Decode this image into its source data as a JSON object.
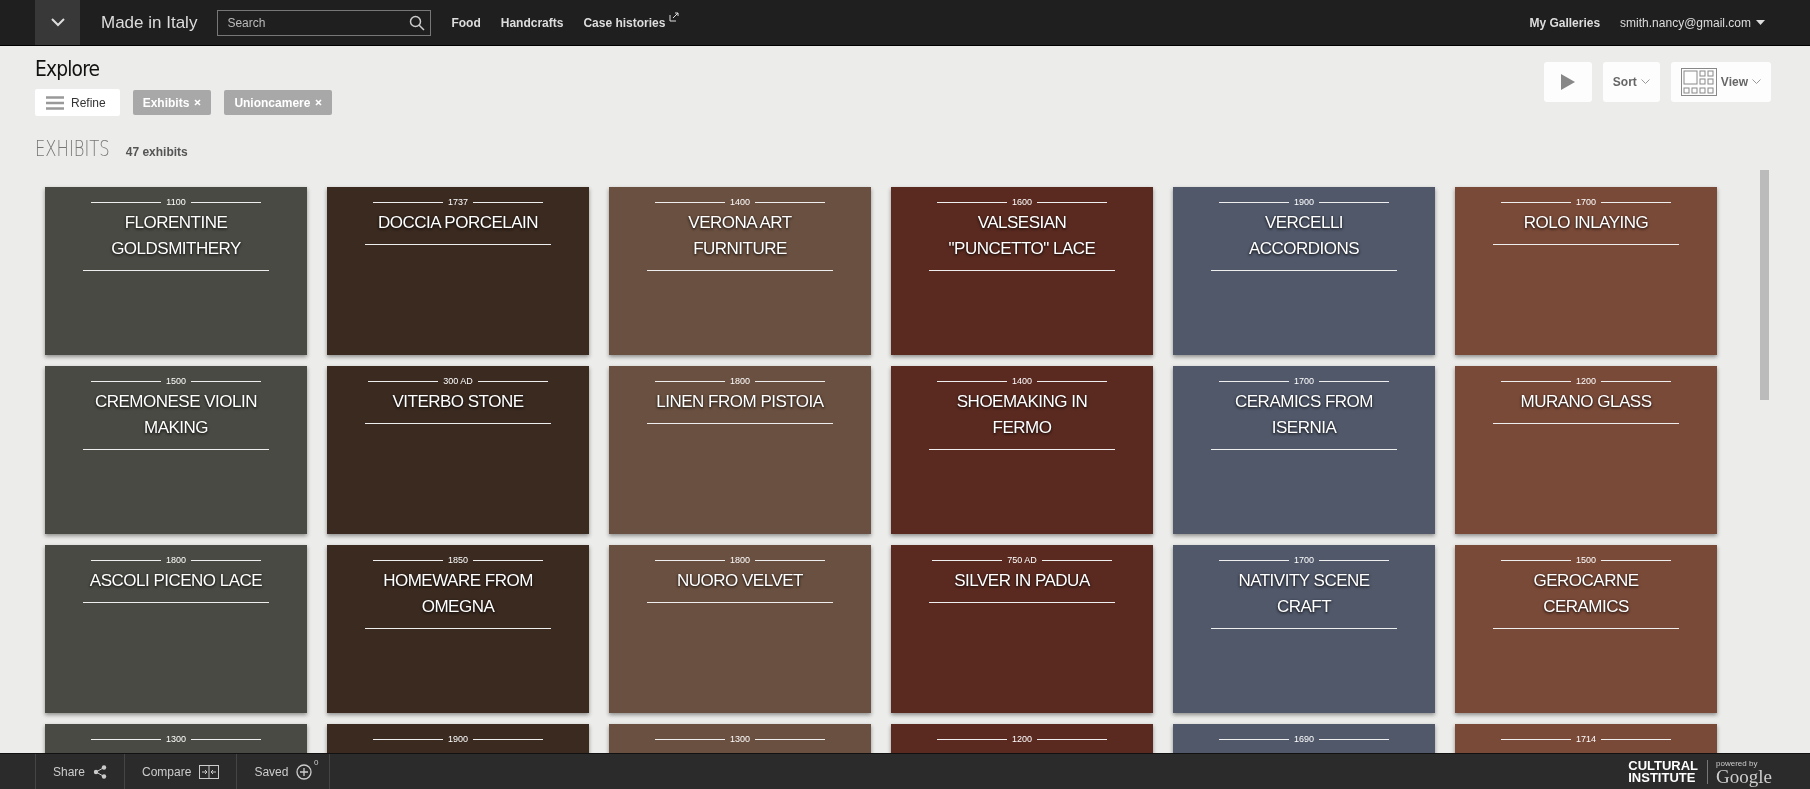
{
  "topbar": {
    "site_title": "Made in Italy",
    "search": {
      "placeholder": "Search"
    },
    "nav": [
      {
        "label": "Food",
        "external": false
      },
      {
        "label": "Handcrafts",
        "external": false
      },
      {
        "label": "Case histories",
        "external": true
      }
    ],
    "galleries": "My Galleries",
    "user": "smith.nancy@gmail.com"
  },
  "page_title": "Explore",
  "refine": "Refine",
  "filters": [
    "Exhibits",
    "Unioncamere"
  ],
  "toolbar": {
    "sort": "Sort",
    "view": "View"
  },
  "section": {
    "title": "EXHIBITS",
    "count": "47 exhibits"
  },
  "exhibits": [
    {
      "year": "1100",
      "title": "FLORENTINE GOLDSMITHERY"
    },
    {
      "year": "1737",
      "title": "DOCCIA PORCELAIN"
    },
    {
      "year": "1400",
      "title": "VERONA ART FURNITURE"
    },
    {
      "year": "1600",
      "title": "VALSESIAN \"PUNCETTO\" LACE"
    },
    {
      "year": "1900",
      "title": "VERCELLI ACCORDIONS"
    },
    {
      "year": "1700",
      "title": "ROLO INLAYING"
    },
    {
      "year": "1500",
      "title": "CREMONESE VIOLIN MAKING"
    },
    {
      "year": "300 AD",
      "title": "VITERBO STONE"
    },
    {
      "year": "1800",
      "title": "LINEN FROM PISTOIA"
    },
    {
      "year": "1400",
      "title": "SHOEMAKING IN FERMO"
    },
    {
      "year": "1700",
      "title": "CERAMICS FROM ISERNIA"
    },
    {
      "year": "1200",
      "title": "MURANO GLASS"
    },
    {
      "year": "1800",
      "title": "ASCOLI PICENO LACE"
    },
    {
      "year": "1850",
      "title": "HOMEWARE FROM OMEGNA"
    },
    {
      "year": "1800",
      "title": "NUORO VELVET"
    },
    {
      "year": "750 AD",
      "title": "SILVER IN PADUA"
    },
    {
      "year": "1700",
      "title": "NATIVITY SCENE CRAFT"
    },
    {
      "year": "1500",
      "title": "GEROCARNE CERAMICS"
    },
    {
      "year": "1300"
    },
    {
      "year": "1900"
    },
    {
      "year": "1300"
    },
    {
      "year": "1200"
    },
    {
      "year": "1690"
    },
    {
      "year": "1714"
    }
  ],
  "bottombar": {
    "share": "Share",
    "compare": "Compare",
    "saved": "Saved",
    "saved_count": "0",
    "logo": [
      "CULTURAL",
      "INSTITUTE"
    ],
    "powered": "powered by",
    "google": "Google"
  }
}
